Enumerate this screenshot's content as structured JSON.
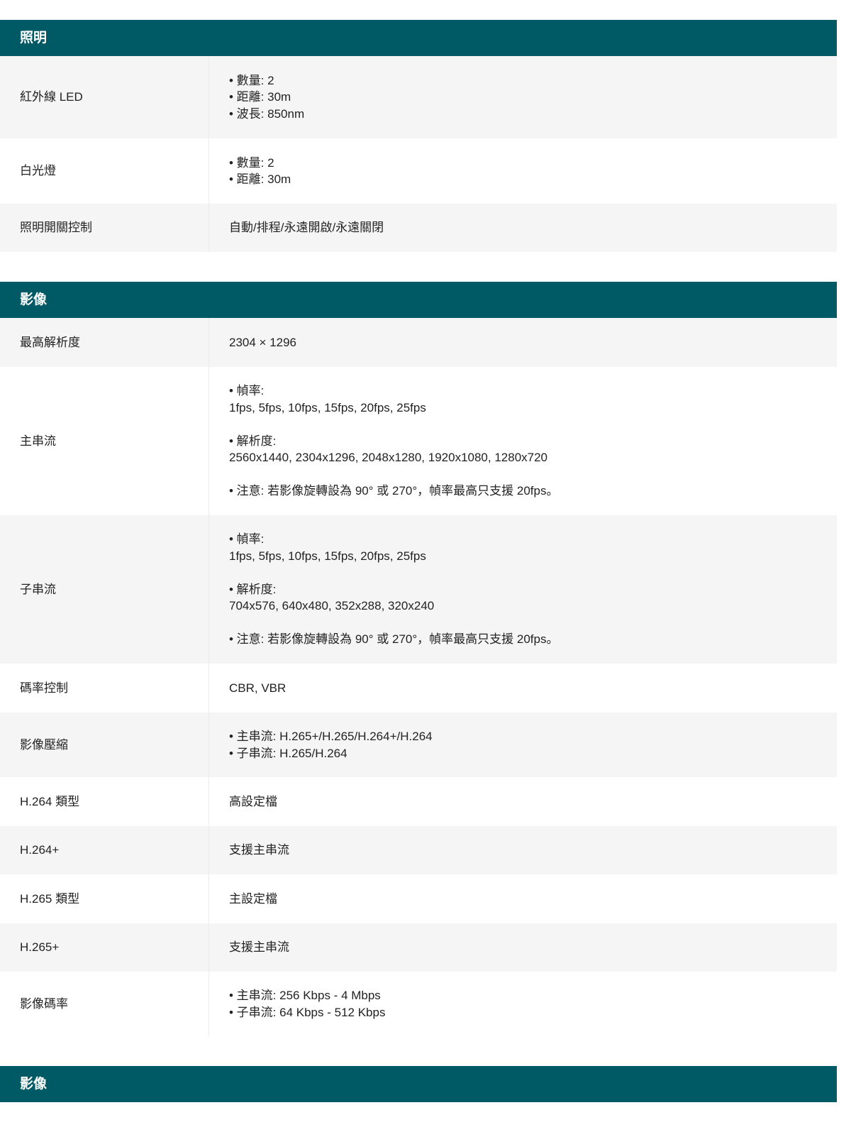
{
  "sections": [
    {
      "title": "照明",
      "rows": [
        {
          "label": "紅外線 LED",
          "lines": [
            "• 數量: 2",
            "• 距離: 30m",
            "• 波長: 850nm"
          ]
        },
        {
          "label": "白光燈",
          "lines": [
            "• 數量: 2",
            "• 距離: 30m"
          ]
        },
        {
          "label": "照明開關控制",
          "lines": [
            "自動/排程/永遠開啟/永遠關閉"
          ]
        }
      ]
    },
    {
      "title": "影像",
      "rows": [
        {
          "label": "最高解析度",
          "lines": [
            "2304 × 1296"
          ]
        },
        {
          "label": "主串流",
          "lines": [
            "• 幀率:",
            "1fps, 5fps, 10fps, 15fps, 20fps, 25fps",
            "",
            "• 解析度:",
            "2560x1440, 2304x1296, 2048x1280, 1920x1080, 1280x720",
            "",
            "• 注意: 若影像旋轉設為 90° 或 270°，幀率最高只支援 20fps。"
          ]
        },
        {
          "label": "子串流",
          "lines": [
            "• 幀率:",
            "1fps, 5fps, 10fps, 15fps, 20fps, 25fps",
            "",
            "• 解析度:",
            "704x576, 640x480, 352x288, 320x240",
            "",
            "• 注意: 若影像旋轉設為 90° 或 270°，幀率最高只支援 20fps。"
          ]
        },
        {
          "label": "碼率控制",
          "lines": [
            "CBR, VBR"
          ]
        },
        {
          "label": "影像壓縮",
          "lines": [
            "• 主串流: H.265+/H.265/H.264+/H.264",
            "• 子串流: H.265/H.264"
          ]
        },
        {
          "label": "H.264 類型",
          "lines": [
            "高設定檔"
          ]
        },
        {
          "label": "H.264+",
          "lines": [
            "支援主串流"
          ]
        },
        {
          "label": "H.265 類型",
          "lines": [
            "主設定檔"
          ]
        },
        {
          "label": "H.265+",
          "lines": [
            "支援主串流"
          ]
        },
        {
          "label": "影像碼率",
          "lines": [
            "• 主串流: 256 Kbps - 4 Mbps",
            "• 子串流: 64 Kbps - 512 Kbps"
          ]
        }
      ]
    },
    {
      "title": "影像",
      "rows": []
    }
  ]
}
